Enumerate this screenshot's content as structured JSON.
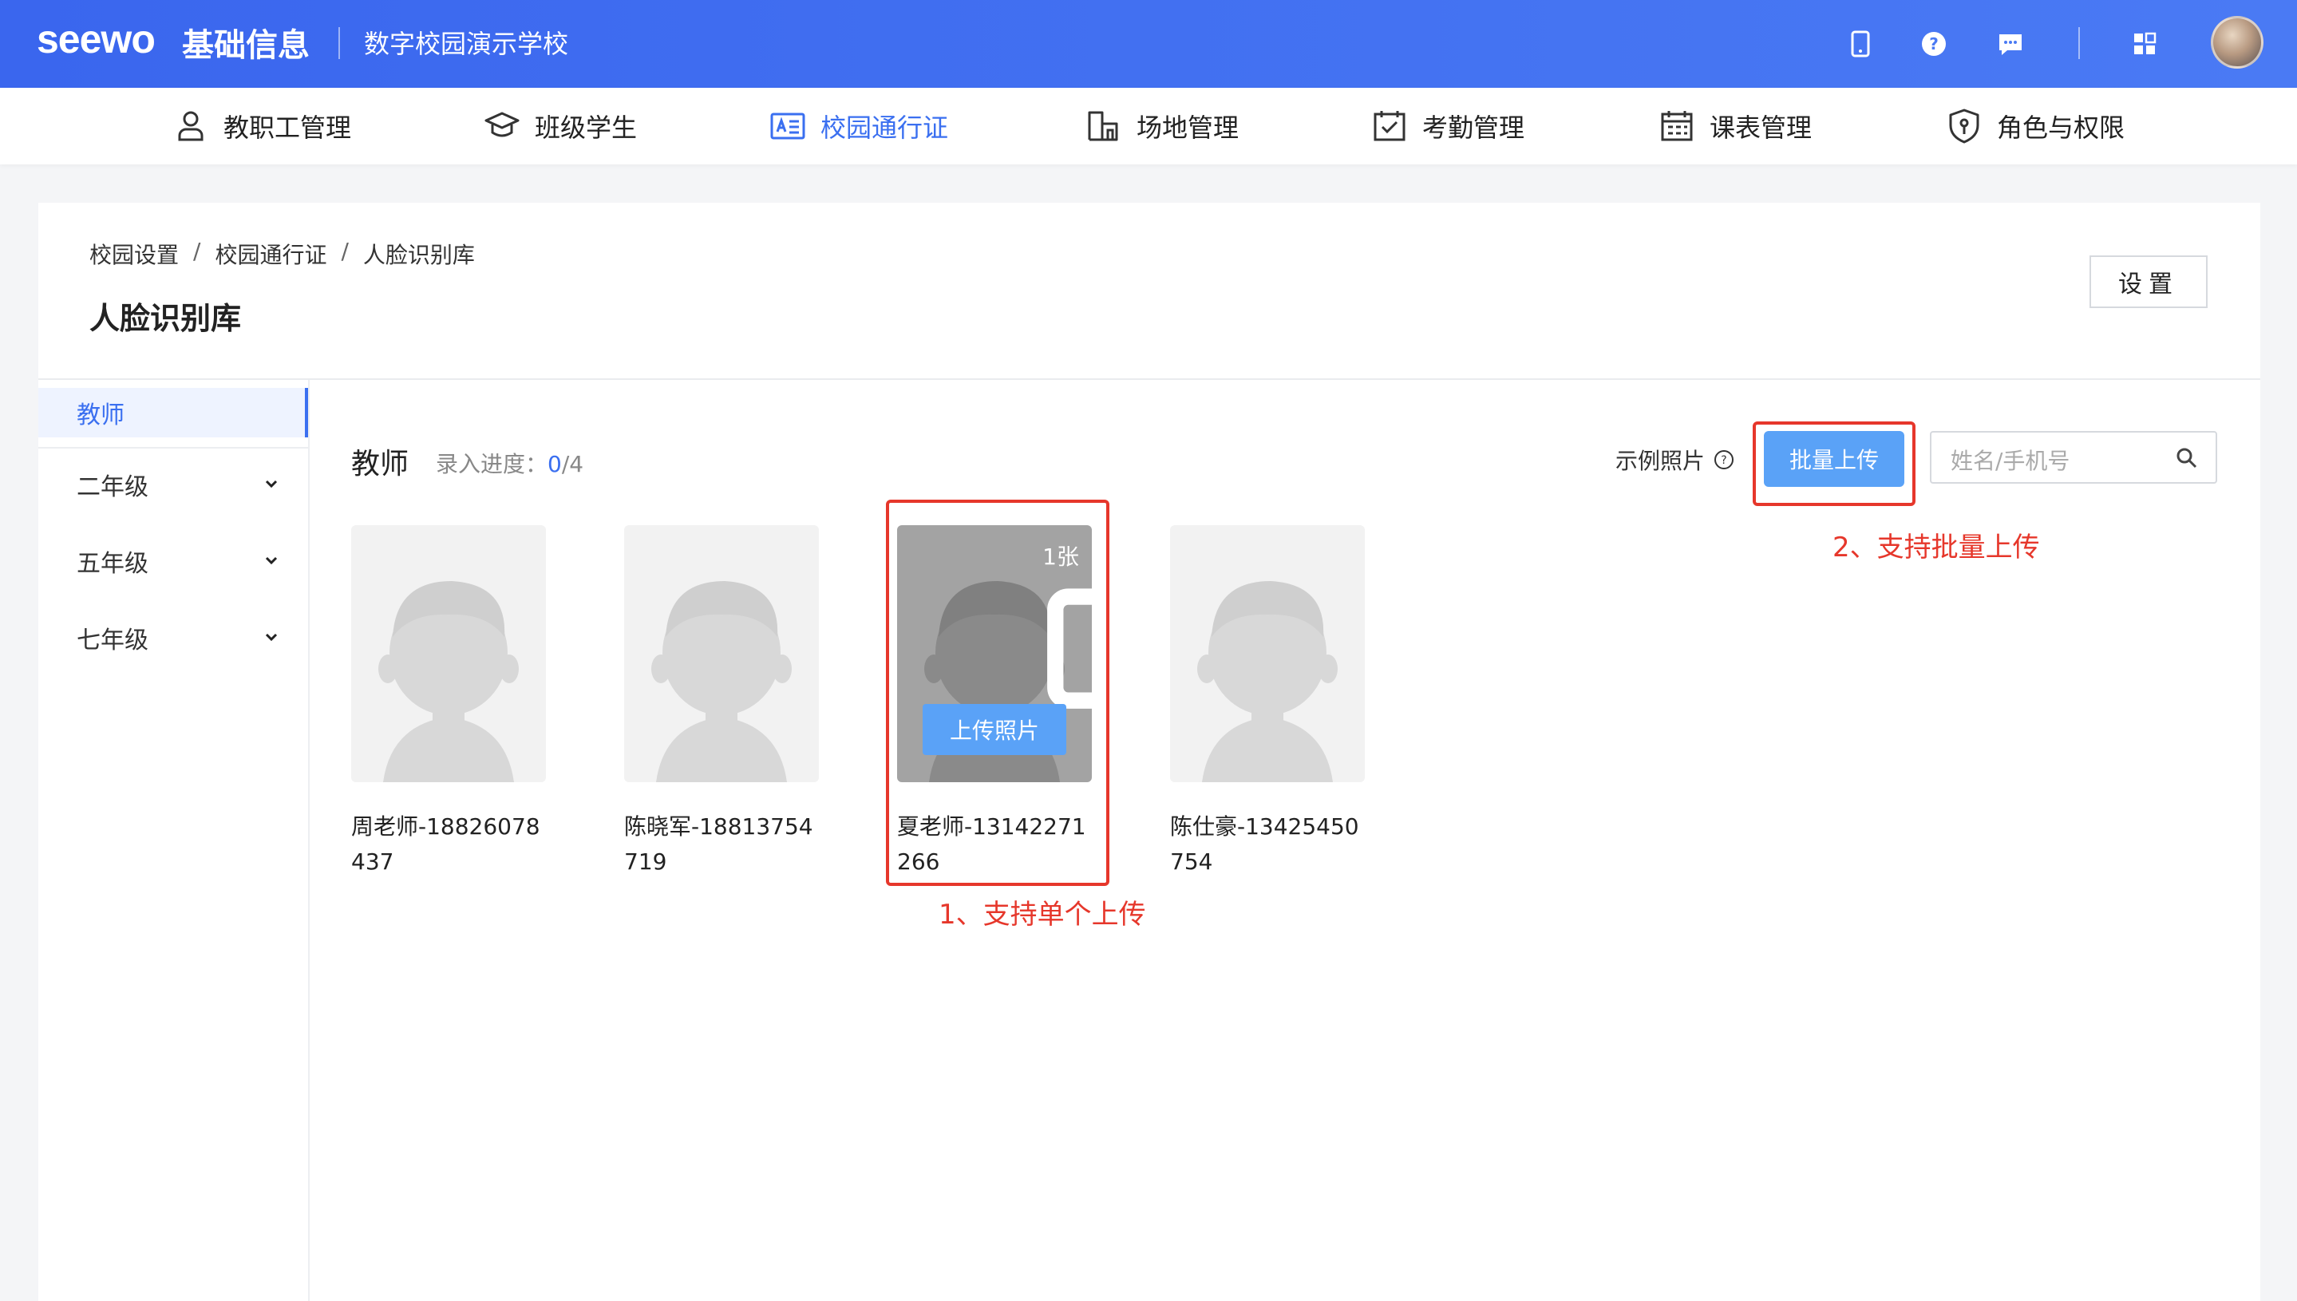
{
  "header": {
    "logo": "seewo",
    "product": "基础信息",
    "school": "数字校园演示学校",
    "icons": [
      "mobile-icon",
      "help-icon",
      "message-icon",
      "apps-icon"
    ]
  },
  "nav": {
    "items": [
      {
        "label": "教职工管理",
        "icon": "user-icon"
      },
      {
        "label": "班级学生",
        "icon": "graduation-cap-icon"
      },
      {
        "label": "校园通行证",
        "icon": "id-card-icon",
        "active": true
      },
      {
        "label": "场地管理",
        "icon": "building-icon"
      },
      {
        "label": "考勤管理",
        "icon": "calendar-check-icon"
      },
      {
        "label": "课表管理",
        "icon": "timetable-icon"
      },
      {
        "label": "角色与权限",
        "icon": "shield-icon"
      }
    ],
    "active_color": "#3a6ff0"
  },
  "breadcrumb": [
    "校园设置",
    "校园通行证",
    "人脸识别库"
  ],
  "page": {
    "title": "人脸识别库",
    "settings_label": "设置"
  },
  "sidebar": {
    "items": [
      {
        "label": "教师",
        "active": true
      },
      {
        "label": "二年级"
      },
      {
        "label": "五年级"
      },
      {
        "label": "七年级"
      }
    ]
  },
  "content": {
    "section_title": "教师",
    "progress_label": "录入进度：",
    "progress_done": "0",
    "progress_total": "/4",
    "sample_label": "示例照片",
    "batch_upload_label": "批量上传",
    "search_placeholder": "姓名/手机号",
    "teachers": [
      {
        "name": "周老师-18826078437"
      },
      {
        "name": "陈晓军-18813754719"
      },
      {
        "name": "夏老师-13142271266",
        "photo_count": "1张",
        "upload_label": "上传照片"
      },
      {
        "name": "陈仕豪-13425450754"
      }
    ]
  },
  "annotations": {
    "single": "1、支持单个上传",
    "batch": "2、支持批量上传",
    "color": "#e6372b"
  }
}
